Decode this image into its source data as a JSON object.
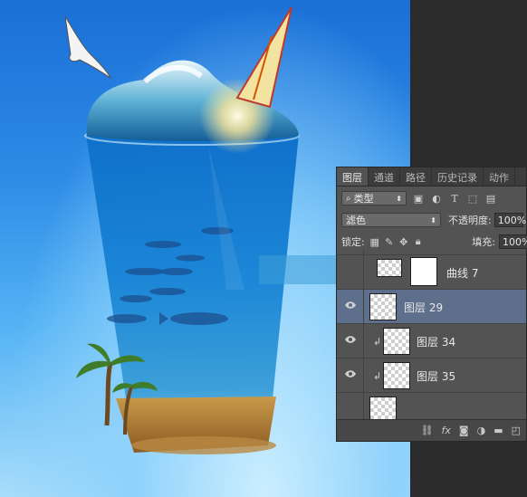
{
  "panel": {
    "tabs": [
      {
        "label": "图层",
        "active": true
      },
      {
        "label": "通道"
      },
      {
        "label": "路径"
      },
      {
        "label": "历史记录"
      },
      {
        "label": "动作"
      }
    ],
    "filter": {
      "label": "类型",
      "icon": "search-icon"
    },
    "blend_mode": "滤色",
    "opacity_label": "不透明度:",
    "opacity_value": "100%",
    "lock_label": "锁定:",
    "fill_label": "填充:",
    "fill_value": "100%",
    "layers": [
      {
        "name": "曲线 7",
        "type": "adjustment",
        "visible": false
      },
      {
        "name": "图层 29",
        "selected": true,
        "visible": true
      },
      {
        "name": "图层 34",
        "clipped": true,
        "visible": true
      },
      {
        "name": "图层 35",
        "clipped": true,
        "visible": true
      }
    ],
    "footer_icons": [
      "link-icon",
      "fx-icon",
      "mask-icon",
      "adjustment-icon",
      "group-folder-icon",
      "new-layer-icon"
    ],
    "footer_fx": "fx"
  },
  "colors": {
    "panel_bg": "#535353",
    "selected_row": "#5d6f8a",
    "sky_top": "#1b6fd6",
    "sky_bottom": "#a8ddfb"
  }
}
